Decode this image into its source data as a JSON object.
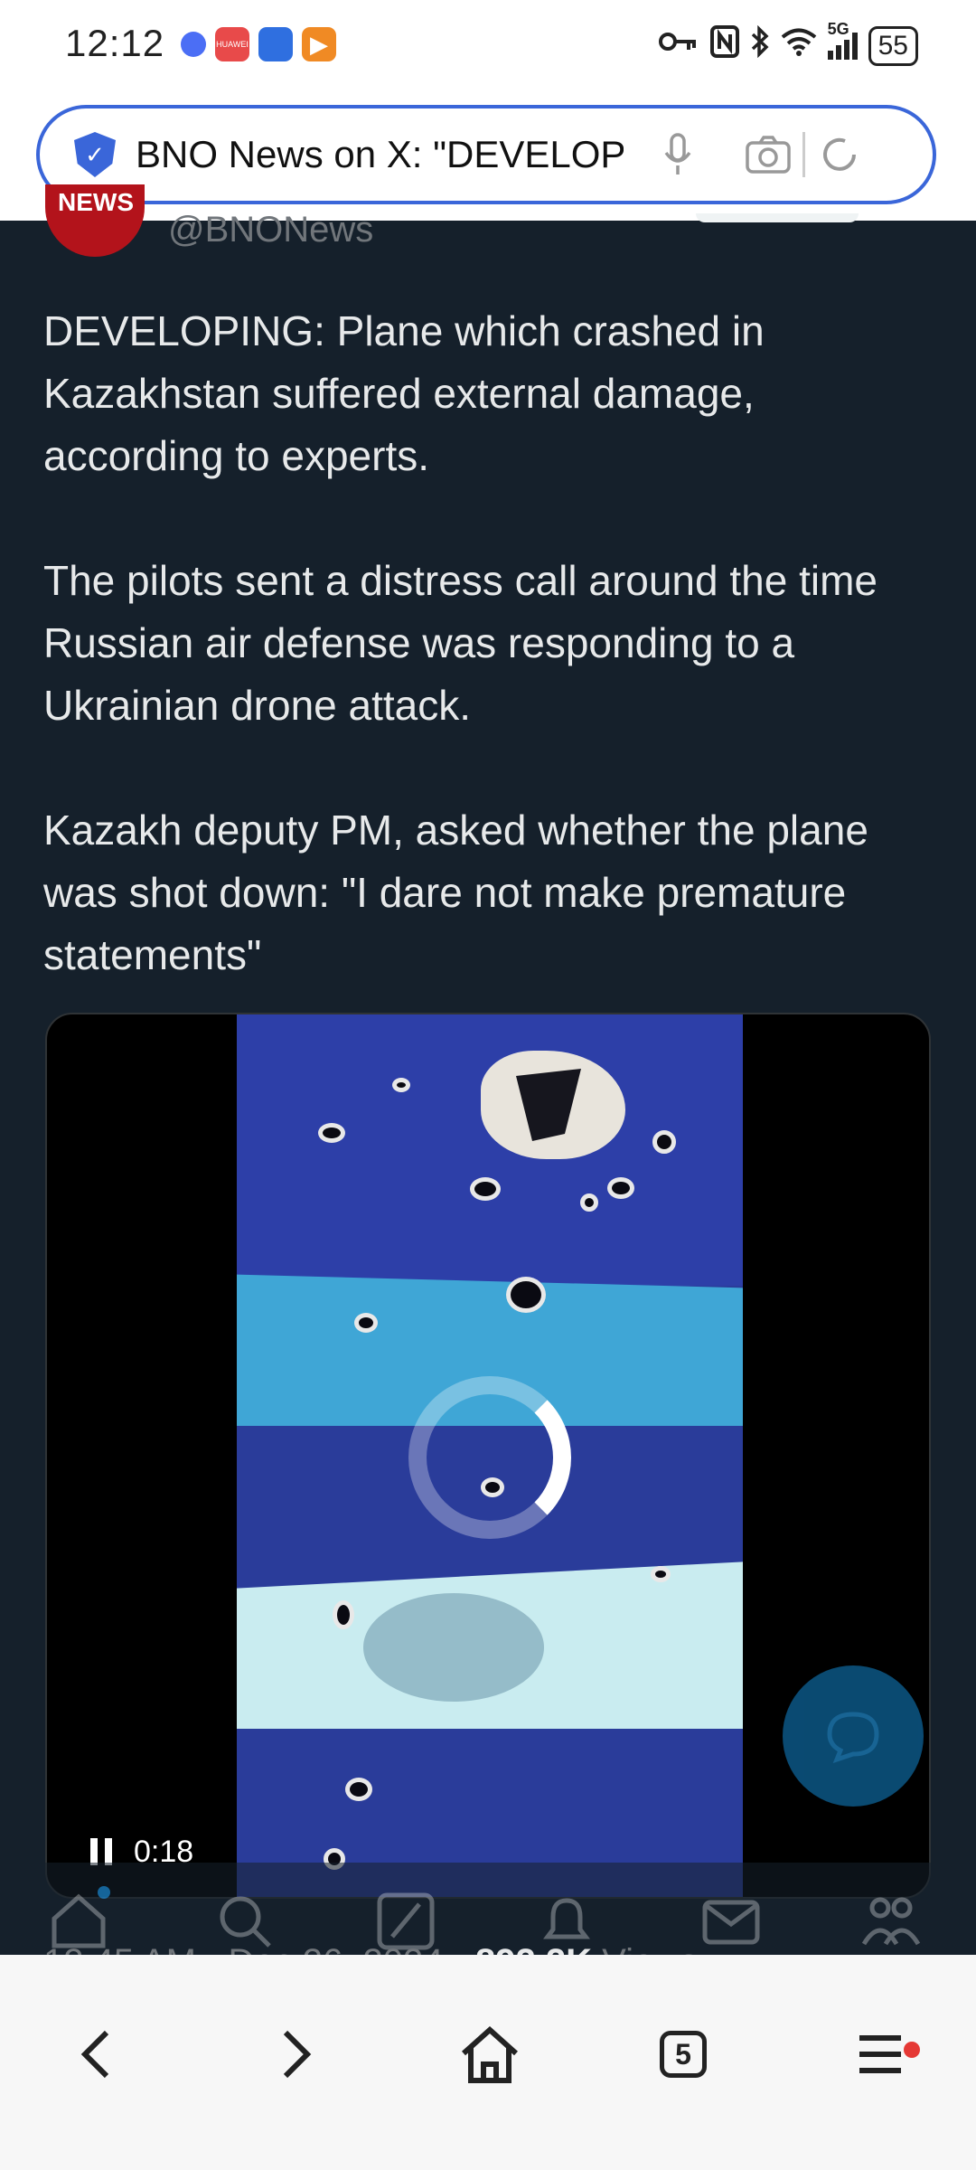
{
  "status_bar": {
    "time": "12:12",
    "app_tile_1": "HUAWEI",
    "battery": "55",
    "network": "5G"
  },
  "browser": {
    "page_title": "BNO News on X: \"DEVELOPING",
    "tab_count": "5"
  },
  "tweet": {
    "avatar_label": "NEWS",
    "handle": "@BNONews",
    "paragraphs": [
      "DEVELOPING: Plane which crashed in Kazakhstan suffered external damage, according to experts.",
      "The pilots sent a distress call around the time Russian air defense was responding to a Ukrainian drone attack.",
      "Kazakh deputy PM, asked whether the plane was shot down: \"I dare not make premature statements\""
    ],
    "video_time": "0:18",
    "timestamp": "12:45 AM · Dec 26, 2024 · ",
    "views_count": "892.2K",
    "views_label": " Views"
  },
  "colors": {
    "background": "#15202b",
    "accent": "#1d9bf0",
    "brand_red": "#b3131b",
    "address_border": "#3a66d9"
  }
}
